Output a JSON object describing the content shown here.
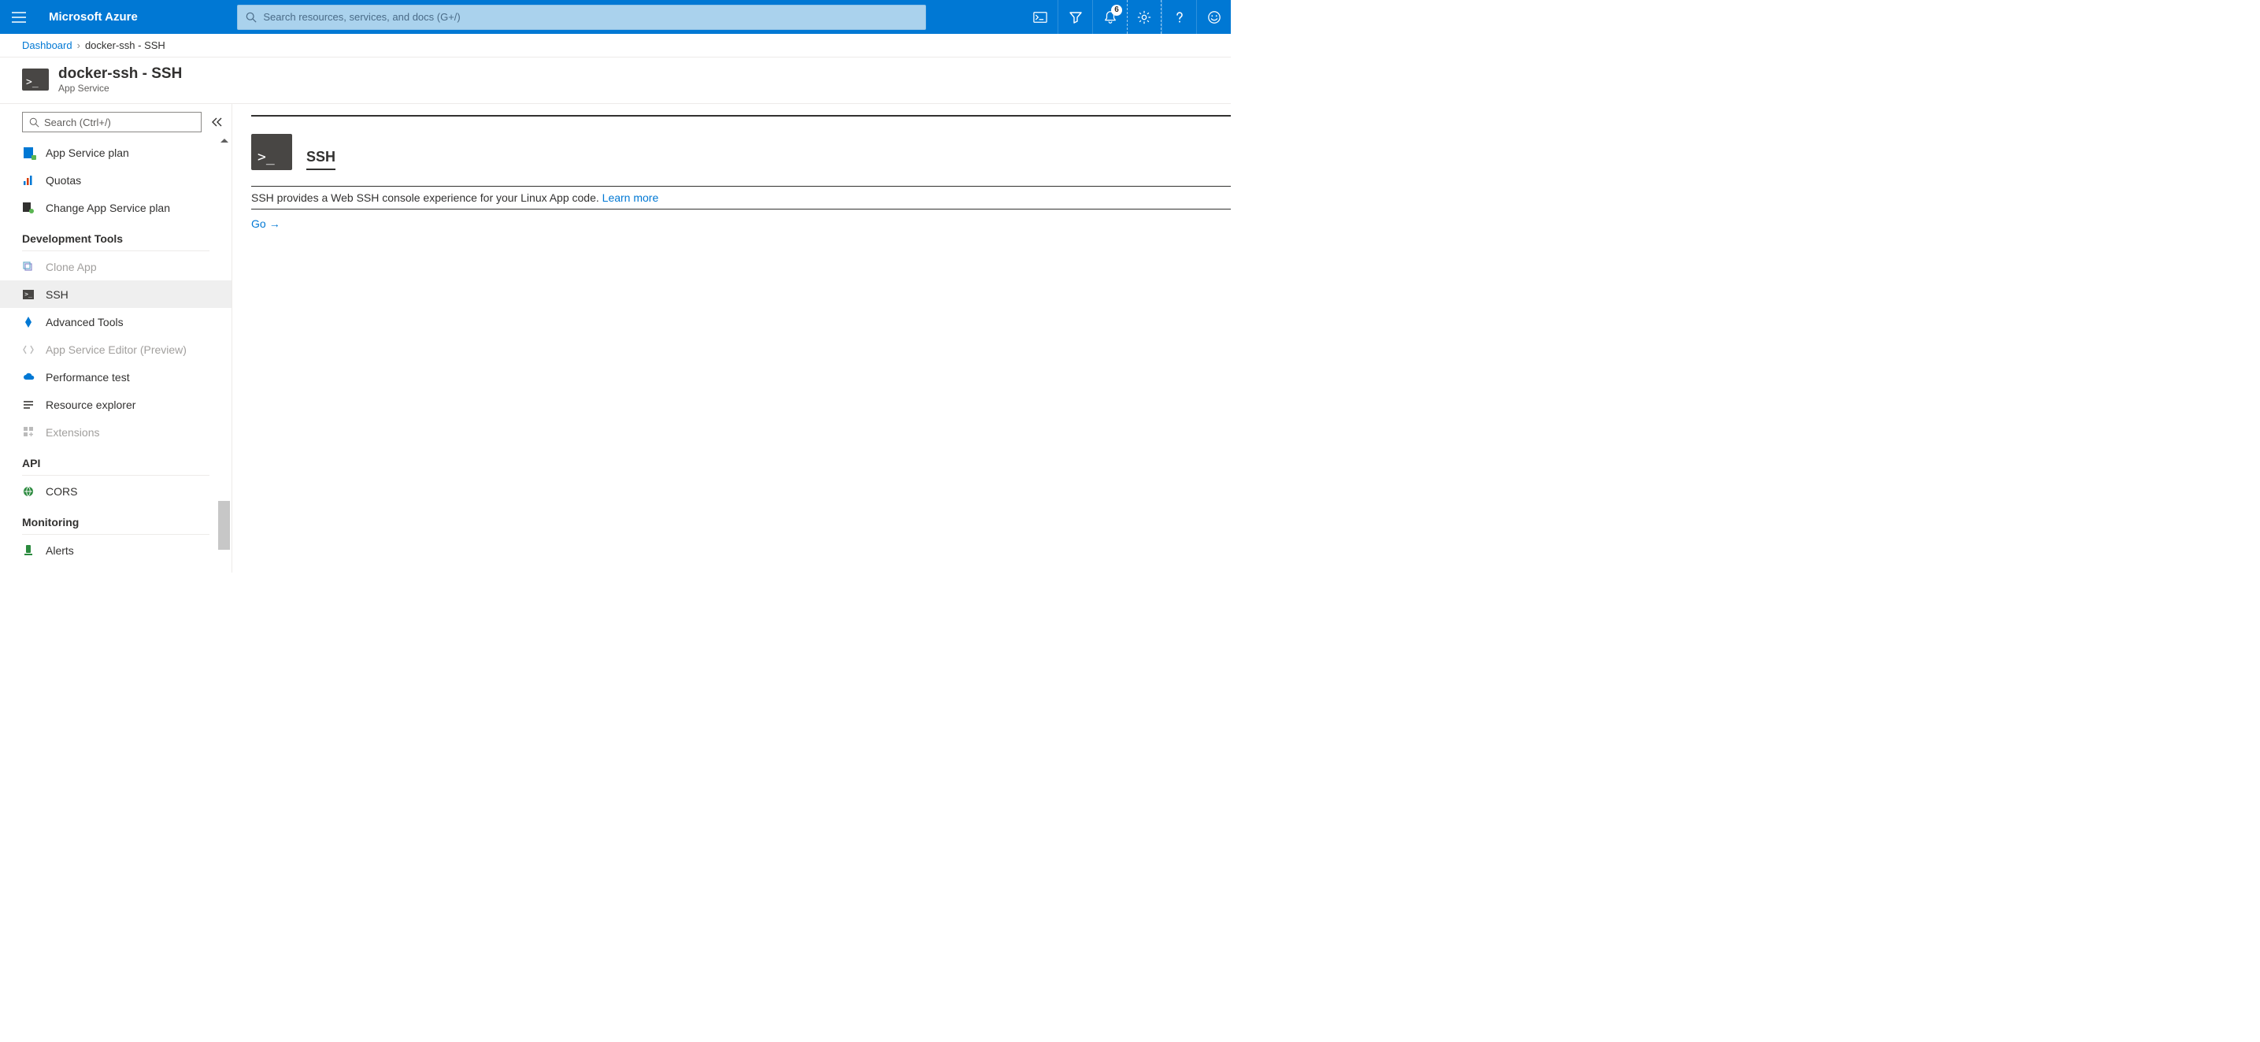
{
  "topbar": {
    "brand": "Microsoft Azure",
    "search_placeholder": "Search resources, services, and docs (G+/)",
    "notification_count": "6"
  },
  "breadcrumb": {
    "root": "Dashboard",
    "current": "docker-ssh - SSH"
  },
  "page": {
    "title": "docker-ssh - SSH",
    "subtitle": "App Service"
  },
  "sidebar": {
    "search_placeholder": "Search (Ctrl+/)",
    "items_top": [
      {
        "label": "App Service plan"
      },
      {
        "label": "Quotas"
      },
      {
        "label": "Change App Service plan"
      }
    ],
    "section_dev": "Development Tools",
    "dev_items": [
      {
        "label": "Clone App",
        "muted": true
      },
      {
        "label": "SSH",
        "selected": true
      },
      {
        "label": "Advanced Tools"
      },
      {
        "label": "App Service Editor (Preview)",
        "muted": true
      },
      {
        "label": "Performance test"
      },
      {
        "label": "Resource explorer"
      },
      {
        "label": "Extensions",
        "muted": true
      }
    ],
    "section_api": "API",
    "api_items": [
      {
        "label": "CORS"
      }
    ],
    "section_monitoring": "Monitoring",
    "monitoring_items": [
      {
        "label": "Alerts"
      }
    ]
  },
  "main": {
    "heading": "SSH",
    "description": "SSH provides a Web SSH console experience for your Linux App code. ",
    "learn_more": "Learn more",
    "go": "Go"
  }
}
